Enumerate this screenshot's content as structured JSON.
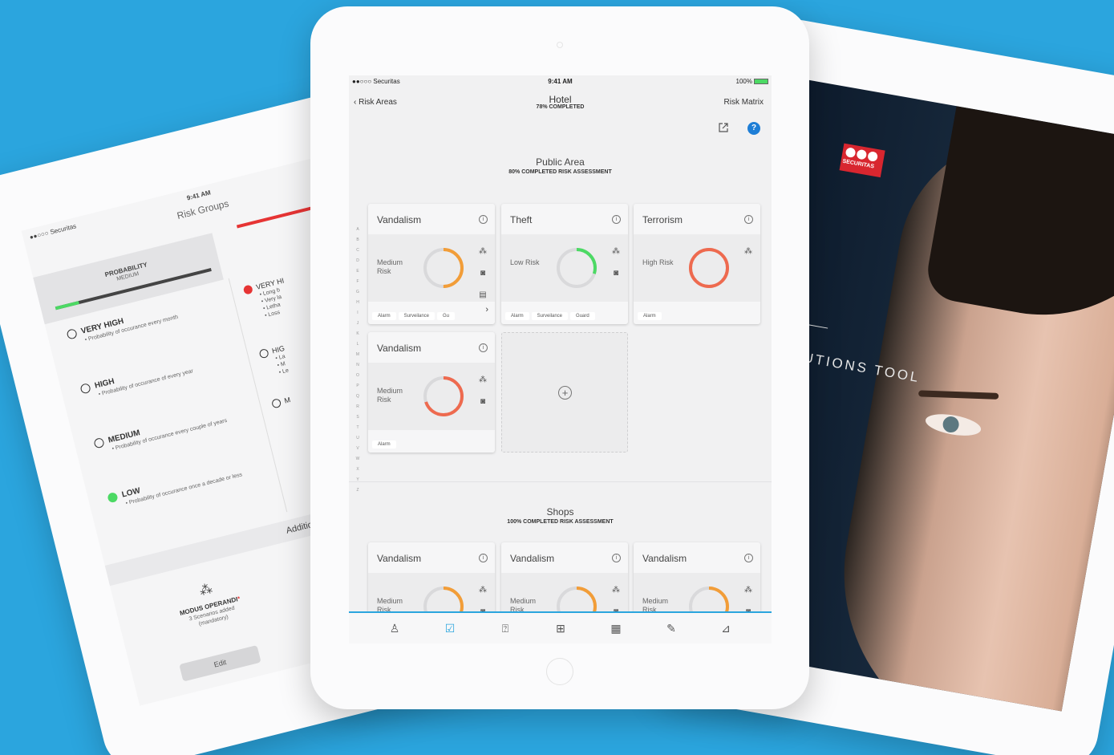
{
  "left_tablet": {
    "status": {
      "carrier": "●●○○○ Securitas",
      "time": "9:41 AM"
    },
    "title": "Risk Groups",
    "probability": {
      "label": "PROBABILITY",
      "value": "MEDIUM",
      "level": 0.15
    },
    "options": [
      {
        "name": "VERY HIGH",
        "desc": "• Probability of occurance every month",
        "checked": false
      },
      {
        "name": "HIGH",
        "desc": "• Probability of occurance of every year",
        "checked": false
      },
      {
        "name": "MEDIUM",
        "desc": "• Probability of occurance every couple of years",
        "checked": false
      },
      {
        "name": "LOW",
        "desc": "• Probability of occurance once a decade or less",
        "checked": true
      }
    ],
    "right_options": [
      {
        "name": "VERY HI",
        "bullets": "• Long b\n• Very la\n• Letha\n• Loss"
      },
      {
        "name": "HIG",
        "bullets": "• La\n• M\n• Le"
      },
      {
        "name": "M",
        "bullets": ""
      }
    ],
    "additional": "Additional Categ",
    "modus": {
      "title": "MODUS OPERANDI",
      "star": "*",
      "sub1": "3 Scenarios added",
      "sub2": "(mandatory)",
      "edit": "Edit"
    },
    "thumb_count": "10"
  },
  "right_tablet": {
    "logo": "SECURITAS",
    "tool_text": "LUTIONS TOOL"
  },
  "center_tablet": {
    "status": {
      "carrier": "●●○○○ Securitas",
      "time": "9:41 AM",
      "battery": "100%",
      "battery_level": 1.0
    },
    "nav": {
      "back": "‹ Risk Areas",
      "title": "Hotel",
      "subtitle": "78% COMPLETED",
      "right": "Risk Matrix"
    },
    "toolbar": {
      "share_icon": "share-icon",
      "help": "?"
    },
    "index_letters": [
      "A",
      "B",
      "C",
      "D",
      "E",
      "F",
      "G",
      "H",
      "I",
      "J",
      "K",
      "L",
      "M",
      "N",
      "O",
      "P",
      "Q",
      "R",
      "S",
      "T",
      "U",
      "V",
      "W",
      "X",
      "Y",
      "Z"
    ],
    "sections": [
      {
        "title": "Public Area",
        "subtitle": "80% COMPLETED RISK ASSESSMENT"
      },
      {
        "title": "Shops",
        "subtitle": "100% COMPLETED RISK ASSESSMENT"
      }
    ],
    "cards": [
      {
        "title": "Vandalism",
        "risk": "Medium Risk",
        "color": "#f29d38",
        "fraction": 0.5,
        "tags": [
          "Alarm",
          "Surveilance",
          "Gu"
        ],
        "more": "›"
      },
      {
        "title": "Theft",
        "risk": "Low Risk",
        "color": "#4cd964",
        "fraction": 0.3,
        "tags": [
          "Alarm",
          "Surveilance",
          "Guard"
        ],
        "more": ""
      },
      {
        "title": "Terrorism",
        "risk": "High Risk",
        "color": "#ee6a4f",
        "fraction": 1.0,
        "tags": [
          "Alarm"
        ],
        "more": ""
      },
      {
        "title": "Vandalism",
        "risk": "Medium Risk",
        "color": "#ee6a4f",
        "fraction": 0.7,
        "tags": [
          "Alarm"
        ],
        "more": ""
      },
      {
        "title": "Vandalism",
        "risk": "Medium Risk",
        "color": "#f29d38",
        "fraction": 0.5,
        "tags": [],
        "more": ""
      },
      {
        "title": "Vandalism",
        "risk": "Medium Risk",
        "color": "#f29d38",
        "fraction": 0.5,
        "tags": [],
        "more": ""
      },
      {
        "title": "Vandalism",
        "risk": "Medium Risk",
        "color": "#f29d38",
        "fraction": 0.5,
        "tags": [],
        "more": ""
      }
    ],
    "info_glyph": "i",
    "add_glyph": "+",
    "tabs": [
      {
        "icon": "person-icon",
        "glyph": "♙",
        "active": false
      },
      {
        "icon": "clipboard-check-icon",
        "glyph": "☑",
        "active": true
      },
      {
        "icon": "question-doc-icon",
        "glyph": "⍰",
        "active": false
      },
      {
        "icon": "toolbox-icon",
        "glyph": "⊞",
        "active": false
      },
      {
        "icon": "grid-icon",
        "glyph": "▦",
        "active": false
      },
      {
        "icon": "edit-icon",
        "glyph": "✎",
        "active": false
      },
      {
        "icon": "chart-icon",
        "glyph": "⊿",
        "active": false
      }
    ]
  }
}
